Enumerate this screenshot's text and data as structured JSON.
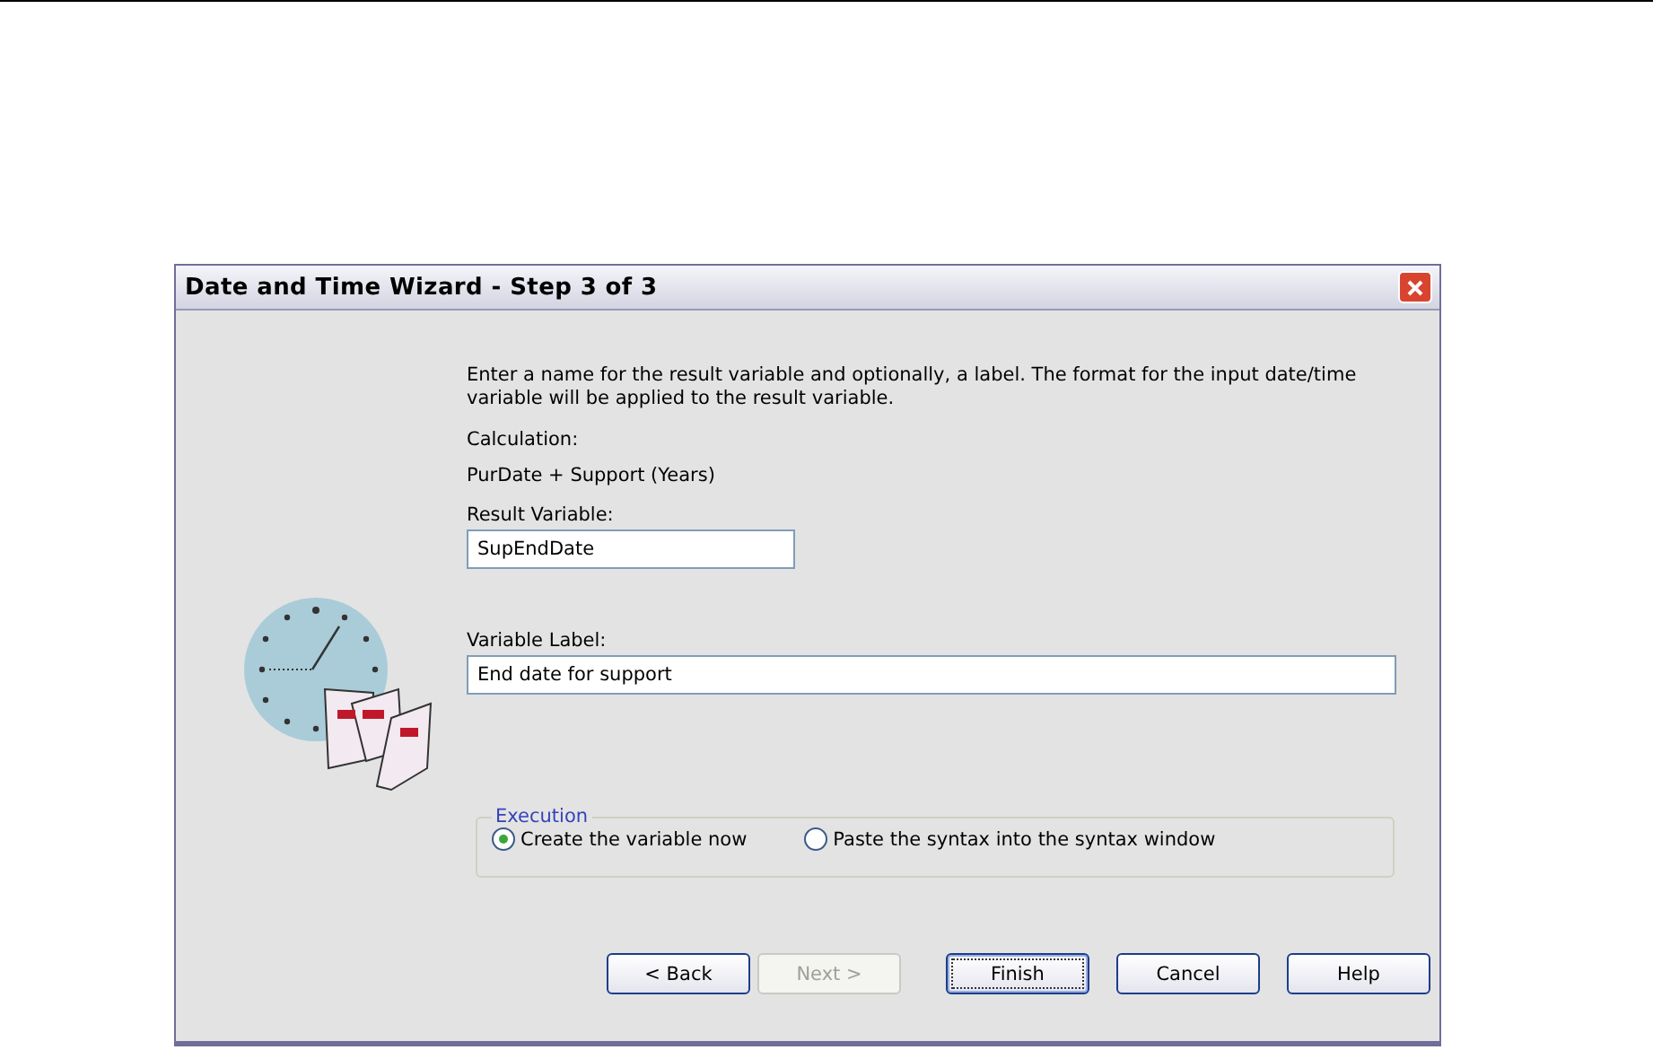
{
  "window": {
    "title": "Date and Time Wizard - Step 3 of 3"
  },
  "intro": "Enter a name for the result variable and optionally, a label. The format for the input date/time variable will be applied to the result variable.",
  "calculation": {
    "label": "Calculation:",
    "formula": "PurDate + Support (Years)"
  },
  "fields": [
    {
      "label": "Result Variable:",
      "value": "SupEndDate",
      "kind": "short"
    },
    {
      "label": "Variable Label:",
      "value": "End date for support",
      "kind": "wide"
    }
  ],
  "execution": {
    "legend": "Execution",
    "options": [
      {
        "label": "Create the variable now",
        "selected": true
      },
      {
        "label": "Paste the syntax into the syntax window",
        "selected": false
      }
    ]
  },
  "buttons": [
    {
      "label": "< Back",
      "disabled": false,
      "default": false
    },
    {
      "label": "Next >",
      "disabled": true,
      "default": false
    },
    {
      "label": "Finish",
      "disabled": false,
      "default": true
    },
    {
      "label": "Cancel",
      "disabled": false,
      "default": false
    },
    {
      "label": "Help",
      "disabled": false,
      "default": false
    }
  ]
}
